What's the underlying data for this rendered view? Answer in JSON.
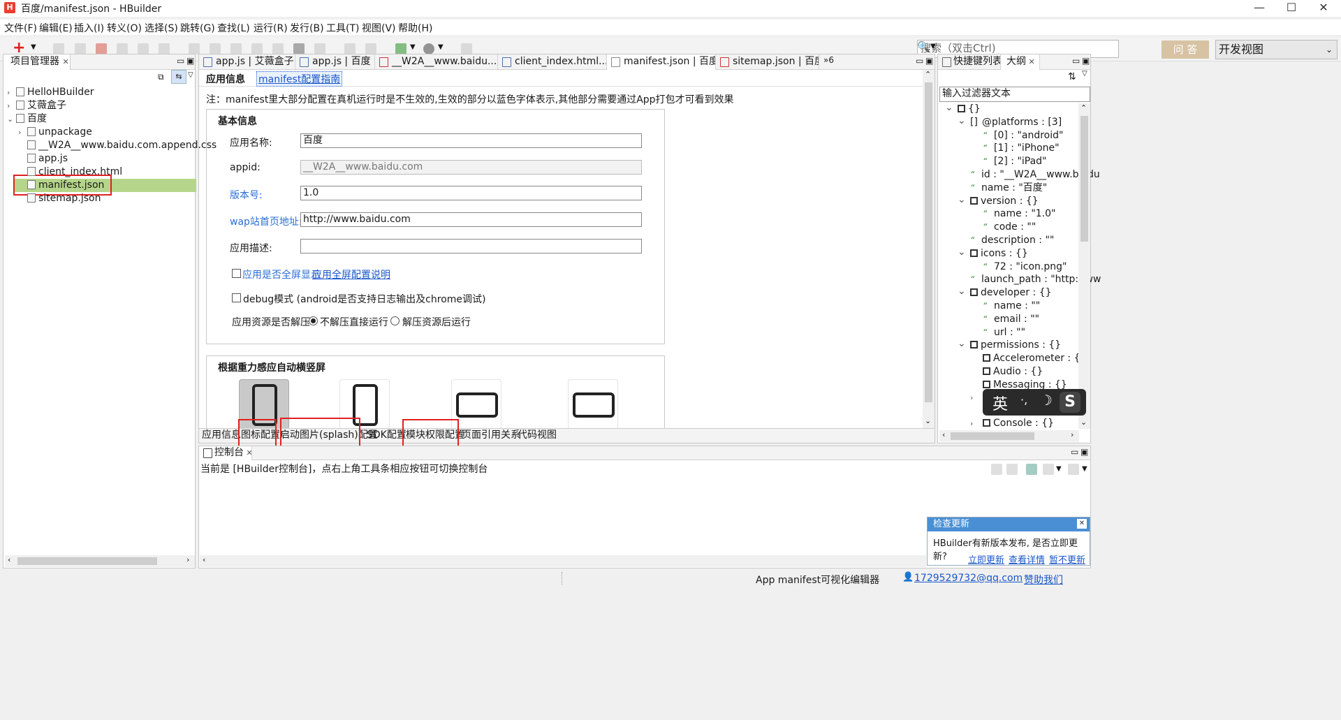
{
  "window": {
    "title": "百度/manifest.json  -  HBuilder",
    "logo": "H"
  },
  "menu": [
    "文件(F)",
    "编辑(E)",
    "插入(I)",
    "转义(O)",
    "选择(S)",
    "跳转(G)",
    "查找(L)",
    "运行(R)",
    "发行(B)",
    "工具(T)",
    "视图(V)",
    "帮助(H)"
  ],
  "toolbar": {
    "search_placeholder": "搜索（双击Ctrl)",
    "qa_label": "问 答",
    "view_label": "开发视图"
  },
  "project_panel": {
    "title": "项目管理器",
    "items": [
      {
        "label": "HelloHBuilder",
        "level": 0,
        "caret": "›"
      },
      {
        "label": "艾薇盒子",
        "level": 0,
        "caret": "›"
      },
      {
        "label": "百度",
        "level": 0,
        "caret": "⌄"
      },
      {
        "label": "unpackage",
        "level": 1,
        "caret": "›"
      },
      {
        "label": "__W2A__www.baidu.com.append.css",
        "level": 1,
        "caret": ""
      },
      {
        "label": "app.js",
        "level": 1,
        "caret": ""
      },
      {
        "label": "client_index.html",
        "level": 1,
        "caret": ""
      },
      {
        "label": "manifest.json",
        "level": 1,
        "caret": ""
      },
      {
        "label": "sitemap.json",
        "level": 1,
        "caret": ""
      }
    ]
  },
  "editor_tabs": [
    {
      "label": "app.js | 艾薇盒子"
    },
    {
      "label": "app.js | 百度"
    },
    {
      "label": "__W2A__www.baidu...."
    },
    {
      "label": "client_index.html..."
    },
    {
      "label": "manifest.json | 百度"
    },
    {
      "label": "sitemap.json | 百度"
    }
  ],
  "editor_tabs_overflow": "»6",
  "editor": {
    "header_title": "应用信息",
    "header_link": "manifest配置指南",
    "note": "注：manifest里大部分配置在真机运行时是不生效的,生效的部分以蓝色字体表示,其他部分需要通过App打包才可看到效果",
    "basic_title": "基本信息",
    "fields": [
      {
        "label": "应用名称:",
        "value": "百度"
      },
      {
        "label": "appid:",
        "value": "__W2A__www.baidu.com"
      },
      {
        "label": "版本号:",
        "value": "1.0"
      },
      {
        "label": "wap站首页地址:",
        "value": "http://www.baidu.com"
      },
      {
        "label": "应用描述:",
        "value": ""
      }
    ],
    "fullscreen_label": "应用是否全屏显示",
    "fullscreen_link": "应用全屏配置说明",
    "debug_label": "debug模式 (android是否支持日志输出及chrome调试)",
    "unpack_label": "应用资源是否解压",
    "radio_no_unpack": "不解压直接运行",
    "radio_unpack": "解压资源后运行",
    "orientation_title": "根据重力感应自动横竖屏"
  },
  "bottom_tabs": [
    "应用信息",
    "图标配置",
    "启动图片(splash)配置",
    "SDK配置",
    "模块权限配置",
    "页面引用关系",
    "代码视图"
  ],
  "right_panel": {
    "tab_shortcuts": "快捷键列表",
    "tab_outline": "大纲",
    "filter_placeholder": "输入过滤器文本",
    "rows": [
      {
        "text": "{}",
        "kind": "obj",
        "caret": "⌄"
      },
      {
        "text": "@platforms : [3]",
        "kind": "arr",
        "caret": "⌄"
      },
      {
        "text": "[0] : \"android\"",
        "kind": "val",
        "caret": ""
      },
      {
        "text": "[1] : \"iPhone\"",
        "kind": "val",
        "caret": ""
      },
      {
        "text": "[2] : \"iPad\"",
        "kind": "val",
        "caret": ""
      },
      {
        "text": "id : \"__W2A__www.baidu",
        "kind": "val",
        "caret": ""
      },
      {
        "text": "name : \"百度\"",
        "kind": "val",
        "caret": ""
      },
      {
        "text": "version : {}",
        "kind": "obj",
        "caret": "⌄"
      },
      {
        "text": "name : \"1.0\"",
        "kind": "val",
        "caret": ""
      },
      {
        "text": "code : \"\"",
        "kind": "val",
        "caret": ""
      },
      {
        "text": "description : \"\"",
        "kind": "val",
        "caret": ""
      },
      {
        "text": "icons : {}",
        "kind": "obj",
        "caret": "⌄"
      },
      {
        "text": "72 : \"icon.png\"",
        "kind": "val",
        "caret": ""
      },
      {
        "text": "launch_path : \"http://ww",
        "kind": "val",
        "caret": ""
      },
      {
        "text": "developer : {}",
        "kind": "obj",
        "caret": "⌄"
      },
      {
        "text": "name : \"\"",
        "kind": "val",
        "caret": ""
      },
      {
        "text": "email : \"\"",
        "kind": "val",
        "caret": ""
      },
      {
        "text": "url : \"\"",
        "kind": "val",
        "caret": ""
      },
      {
        "text": "permissions : {}",
        "kind": "obj",
        "caret": "⌄"
      },
      {
        "text": "Accelerometer : {}",
        "kind": "obj",
        "caret": ""
      },
      {
        "text": "Audio : {}",
        "kind": "obj",
        "caret": ""
      },
      {
        "text": "Messaging : {}",
        "kind": "obj",
        "caret": ""
      }
    ],
    "last_row": "Console : {}"
  },
  "console": {
    "title": "控制台",
    "message": "当前是 [HBuilder控制台]，点右上角工具条相应按钮可切换控制台"
  },
  "notification": {
    "title": "检查更新",
    "message": "HBuilder有新版本发布, 是否立即更新?",
    "update_now": "立即更新",
    "details": "查看详情",
    "later": "暂不更新"
  },
  "ime": {
    "label": "英",
    "extra": "·, "
  },
  "status": {
    "editor_name": "App manifest可视化编辑器",
    "user": "1729529732@qq.com",
    "sponsor": "赞助我们"
  },
  "colors": {
    "accent_red": "#e02020",
    "selection_green": "#b5d68a",
    "link_blue": "#1a56c9"
  }
}
